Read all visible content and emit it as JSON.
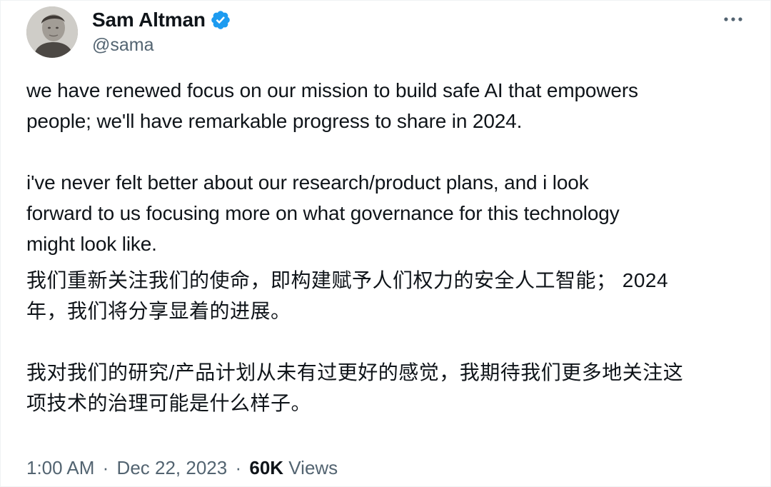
{
  "author": {
    "display_name": "Sam Altman",
    "handle": "@sama",
    "verified": true,
    "verified_color": "#1d9bf0",
    "avatar_icon": "avatar-photo"
  },
  "menu": {
    "more_icon": "more-horizontal-icon"
  },
  "tweet": {
    "paragraph_1": "we have renewed focus on our mission to build safe AI that empowers\npeople; we'll have remarkable progress to share in 2024.",
    "paragraph_2": "i've never felt better about our research/product plans, and i look\nforward to us focusing more on what governance for this technology\nmight look like.",
    "paragraph_3": "我们重新关注我们的使命，即构建赋予人们权力的安全人工智能； 2024\n年，我们将分享显着的进展。",
    "paragraph_4": "我对我们的研究/产品计划从未有过更好的感觉，我期待我们更多地关注这\n项技术的治理可能是什么样子。"
  },
  "meta": {
    "time": "1:00 AM",
    "separator": "·",
    "date": "Dec 22, 2023",
    "views_count": "60K",
    "views_label": "Views"
  },
  "colors": {
    "text_primary": "#0f1419",
    "text_secondary": "#536471",
    "border": "#eff3f4"
  }
}
